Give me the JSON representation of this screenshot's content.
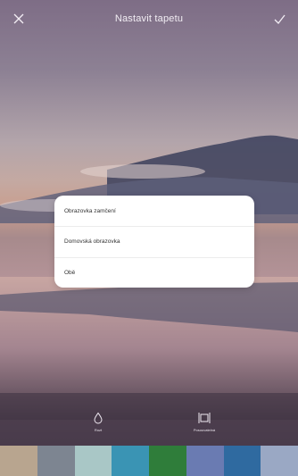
{
  "header": {
    "title": "Nastavit tapetu"
  },
  "dialog": {
    "options": [
      {
        "label": "Obrazovka zamčení"
      },
      {
        "label": "Domovská obrazovka"
      },
      {
        "label": "Obě"
      }
    ]
  },
  "actions": {
    "blur_label": "Rozt",
    "scroll_label": "Posouvatelná"
  },
  "thumbnails": [
    {
      "color": "#b8a58f"
    },
    {
      "color": "#7d8591"
    },
    {
      "color": "#a9c7c6"
    },
    {
      "color": "#3a94b4"
    },
    {
      "color": "#2f7d3a"
    },
    {
      "color": "#6a7bb2"
    },
    {
      "color": "#2f6aa0"
    },
    {
      "color": "#9aa8c4"
    }
  ]
}
